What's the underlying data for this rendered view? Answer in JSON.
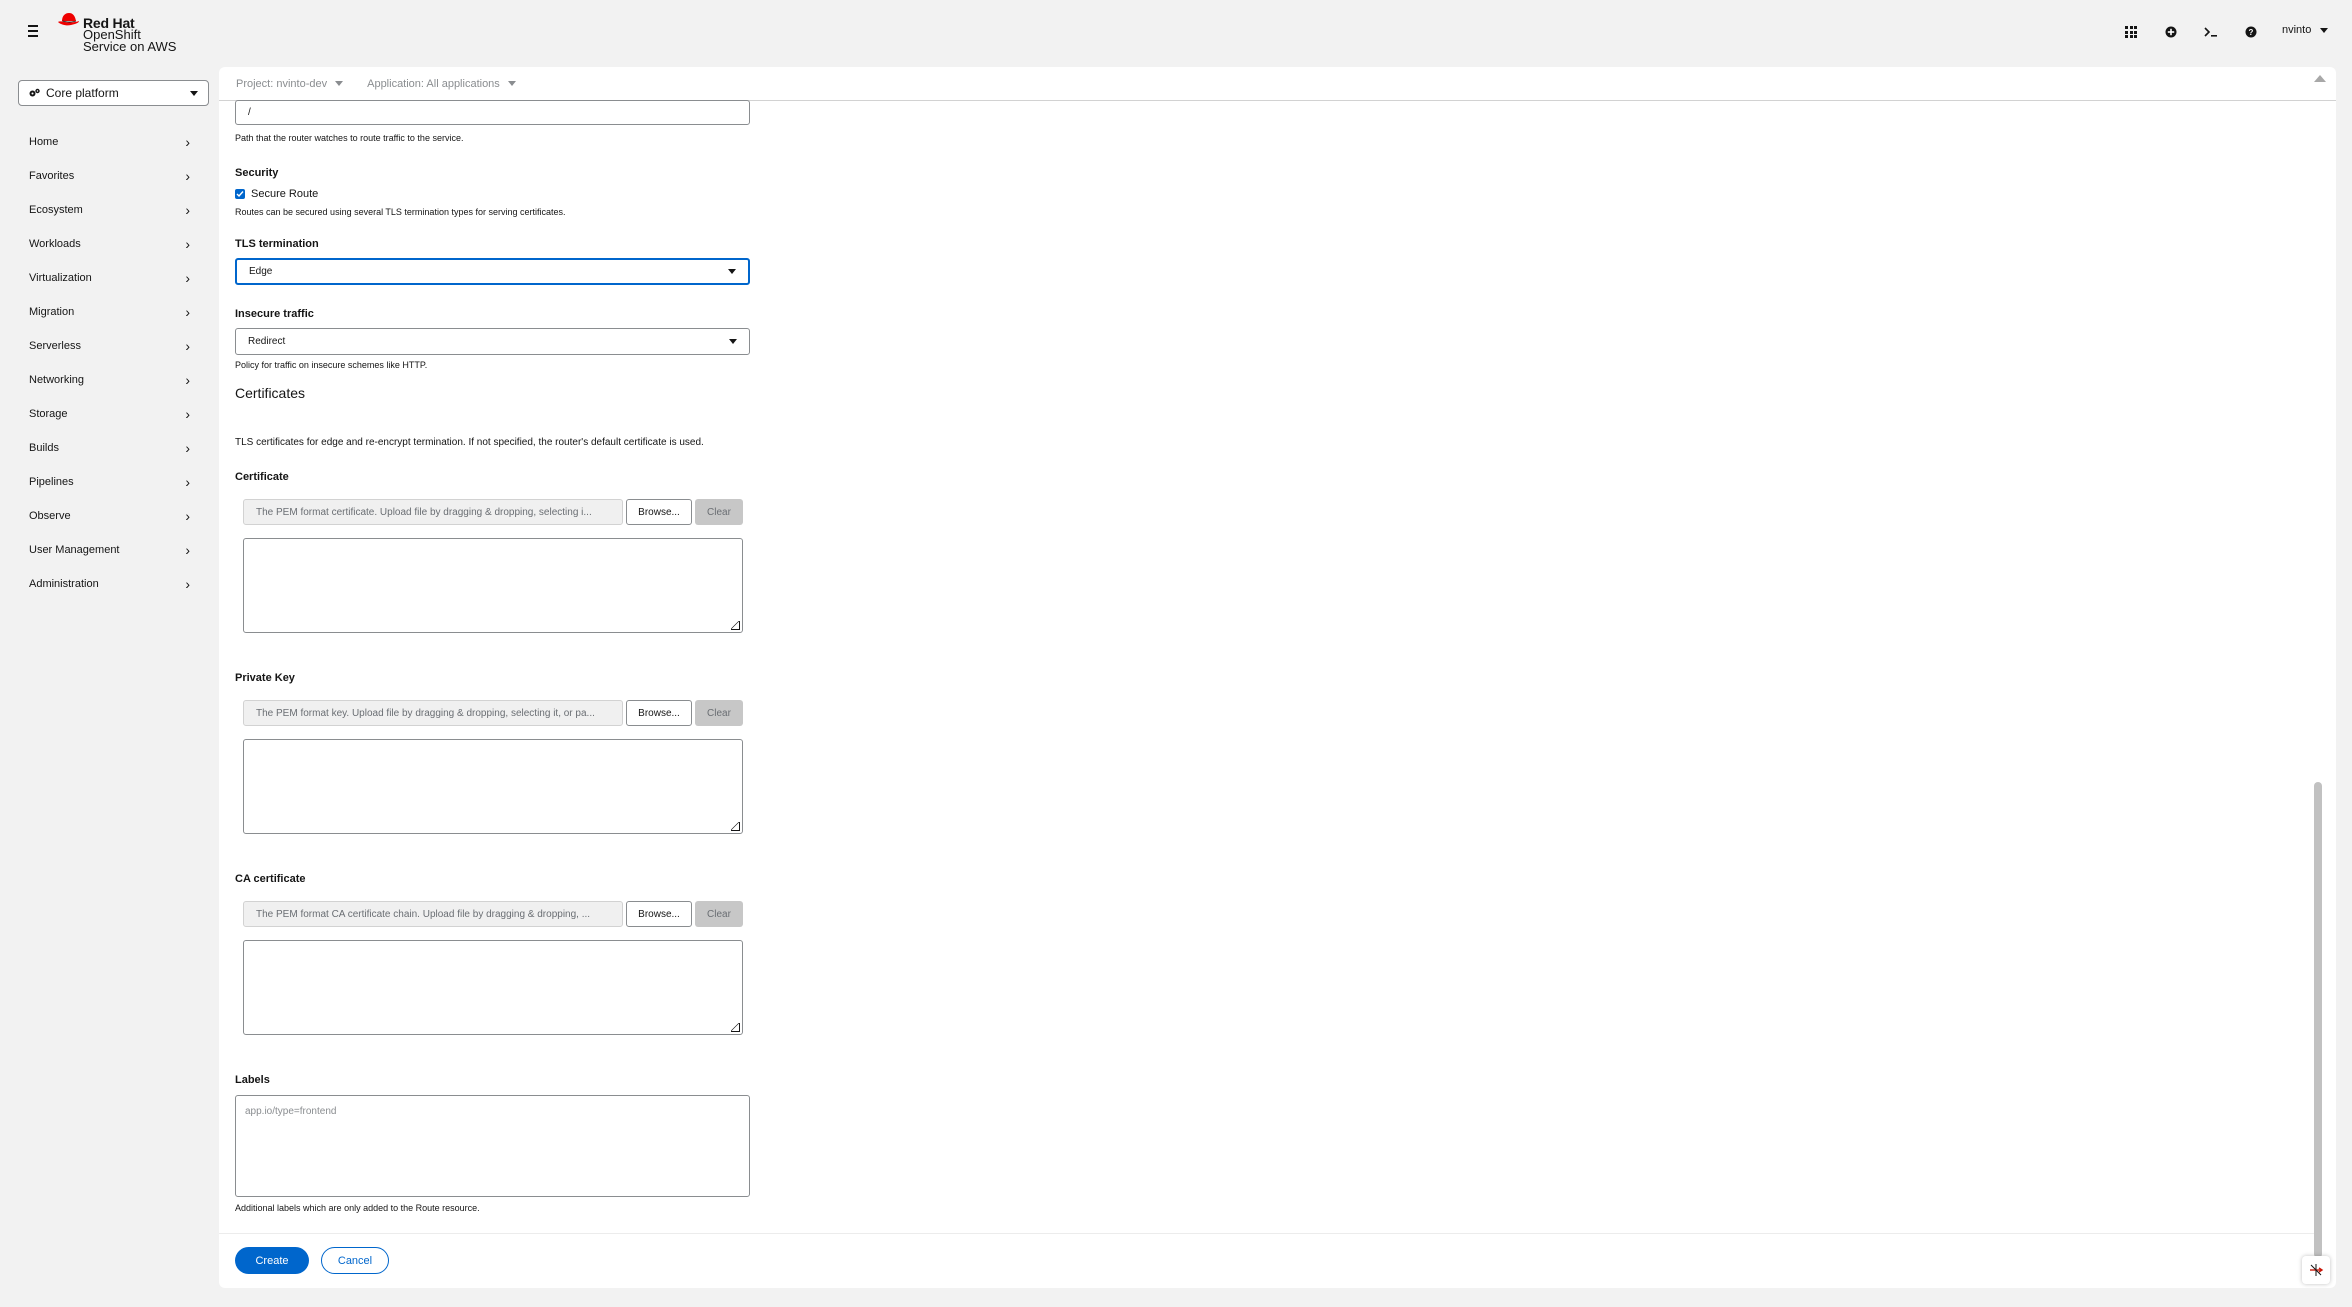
{
  "brand": {
    "line1": "Red Hat",
    "line2": "OpenShift",
    "line3": "Service on AWS"
  },
  "masthead": {
    "icons": [
      "grid-icon",
      "plus-circle-icon",
      "terminal-icon",
      "help-icon"
    ],
    "user": "nvinto"
  },
  "sidebar": {
    "perspective": "Core platform",
    "items": [
      {
        "label": "Home"
      },
      {
        "label": "Favorites"
      },
      {
        "label": "Ecosystem"
      },
      {
        "label": "Workloads"
      },
      {
        "label": "Virtualization"
      },
      {
        "label": "Migration"
      },
      {
        "label": "Serverless"
      },
      {
        "label": "Networking"
      },
      {
        "label": "Storage"
      },
      {
        "label": "Builds"
      },
      {
        "label": "Pipelines"
      },
      {
        "label": "Observe"
      },
      {
        "label": "User Management"
      },
      {
        "label": "Administration"
      }
    ]
  },
  "context": {
    "project": "Project: nvinto-dev",
    "application": "Application: All applications"
  },
  "form": {
    "path_value": "/",
    "path_help": "Path that the router watches to route traffic to the service.",
    "security_label": "Security",
    "secure_route_label": "Secure Route",
    "secure_route_help": "Routes can be secured using several TLS termination types for serving certificates.",
    "tls_label": "TLS termination",
    "tls_value": "Edge",
    "insecure_label": "Insecure traffic",
    "insecure_value": "Redirect",
    "insecure_help": "Policy for traffic on insecure schemes like HTTP.",
    "certs_heading": "Certificates",
    "certs_desc": "TLS certificates for edge and re-encrypt termination. If not specified, the router's default certificate is used.",
    "certificate": {
      "label": "Certificate",
      "placeholder": "The PEM format certificate. Upload file by dragging & dropping, selecting i...",
      "browse": "Browse...",
      "clear": "Clear"
    },
    "private_key": {
      "label": "Private Key",
      "placeholder": "The PEM format key. Upload file by dragging & dropping, selecting it, or pa...",
      "browse": "Browse...",
      "clear": "Clear"
    },
    "ca_certificate": {
      "label": "CA certificate",
      "placeholder": "The PEM format CA certificate chain. Upload file by dragging & dropping, ...",
      "browse": "Browse...",
      "clear": "Clear"
    },
    "labels_label": "Labels",
    "labels_placeholder": "app.io/type=frontend",
    "labels_help": "Additional labels which are only added to the Route resource.",
    "create": "Create",
    "cancel": "Cancel"
  },
  "colors": {
    "primary": "#0066cc",
    "brand_red": "#ee0000"
  }
}
